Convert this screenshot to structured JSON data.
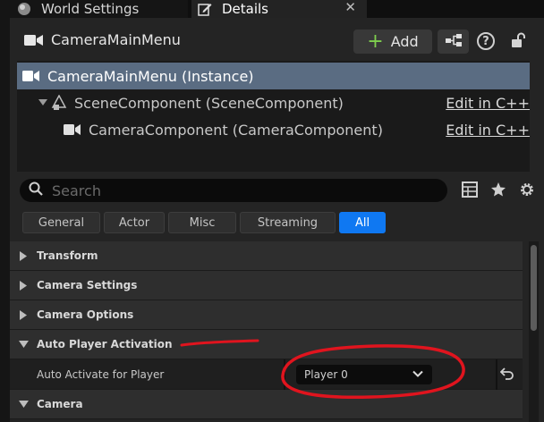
{
  "tabs": {
    "world_settings": "World Settings",
    "details": "Details",
    "close": "✕"
  },
  "header": {
    "title": "CameraMainMenu",
    "add_label": "Add",
    "help_label": "?"
  },
  "components": [
    {
      "label": "CameraMainMenu (Instance)",
      "edit": ""
    },
    {
      "label": "SceneComponent (SceneComponent)",
      "edit": "Edit in C++"
    },
    {
      "label": "CameraComponent (CameraComponent)",
      "edit": "Edit in C++"
    }
  ],
  "search": {
    "placeholder": "Search"
  },
  "filters": [
    "General",
    "Actor",
    "Misc",
    "Streaming",
    "All"
  ],
  "filter_active": "All",
  "categories": [
    {
      "label": "Transform",
      "expanded": false
    },
    {
      "label": "Camera Settings",
      "expanded": false
    },
    {
      "label": "Camera Options",
      "expanded": false
    },
    {
      "label": "Auto Player Activation",
      "expanded": true
    },
    {
      "label": "Camera",
      "expanded": true
    }
  ],
  "property": {
    "label": "Auto Activate for Player",
    "value": "Player 0"
  },
  "colors": {
    "accent": "#0f78f2",
    "selection": "#5a6c82",
    "annotation": "#e0141e",
    "add_plus": "#7fcf4e"
  }
}
